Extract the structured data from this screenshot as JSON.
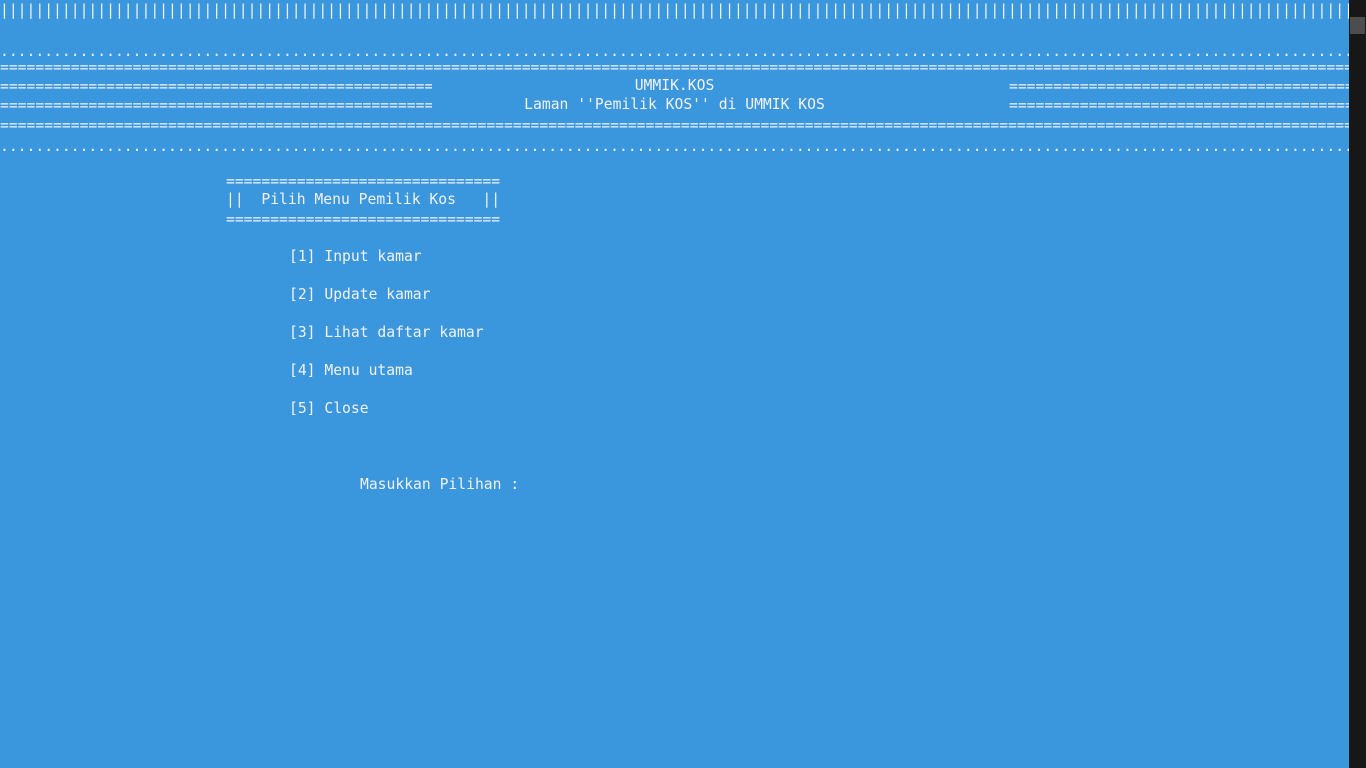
{
  "banner": {
    "top_bars": "|||||||||||||||||||||||||||||||||||||||||||||||||||||||||||||||||||||||||||||||||||||||||||||||||||||||||||||||||||||||||||||||||||||||||||||||||||||||||||||||||||||||||||||||||||||||||||||||||||||||||||||||||||||||||||||||||||||||||||||||||||||||||||||||",
    "dots": "..................................................................................................................................................................................................................................",
    "equals": "==================================================================================================================================================================================================================================",
    "side_equals": "==============================================================================================",
    "title": "UMMIK.KOS",
    "subtitle": "Laman ''Pemilik KOS'' di UMMIK KOS"
  },
  "menu": {
    "border": "===============================",
    "header": "||  Pilih Menu Pemilik Kos   ||",
    "items": [
      {
        "label": "[1] Input kamar"
      },
      {
        "label": "[2] Update kamar"
      },
      {
        "label": "[3] Lihat daftar kamar"
      },
      {
        "label": "[4] Menu utama"
      },
      {
        "label": "[5] Close"
      }
    ]
  },
  "prompt": {
    "label": "Masukkan Pilihan :"
  },
  "colors": {
    "background": "#3a96dd",
    "text": "#f2f2f2",
    "scrollbar": "#171717",
    "scroll_thumb": "#4d4d4d"
  }
}
